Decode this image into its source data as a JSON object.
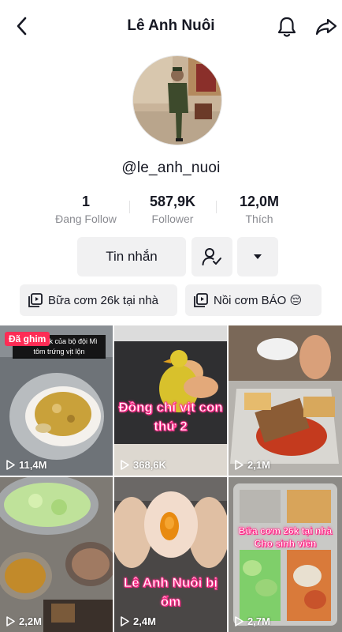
{
  "header": {
    "title": "Lê Anh Nuôi"
  },
  "profile": {
    "username": "@le_anh_nuoi"
  },
  "stats": [
    {
      "value": "1",
      "label": "Đang Follow"
    },
    {
      "value": "587,9K",
      "label": "Follower"
    },
    {
      "value": "12,0M",
      "label": "Thích"
    }
  ],
  "actions": {
    "message_label": "Tin nhắn"
  },
  "playlists": [
    {
      "label": "Bữa cơm 26k tại nhà"
    },
    {
      "label": "Nồi cơm BÁO 😔"
    }
  ],
  "videos": [
    {
      "views": "11,4M",
      "badge": "Đã ghim",
      "caption": "bữa ăn 3k của bộ đội Mì tôm trứng vịt lộn"
    },
    {
      "views": "368,6K",
      "caption": "Đồng chí vịt con thứ 2"
    },
    {
      "views": "2,1M"
    },
    {
      "views": "2,2M"
    },
    {
      "views": "2,4M",
      "caption": "Lê Anh Nuôi bị ốm"
    },
    {
      "views": "2,7M",
      "caption": "Bữa cơm 26k tại nhà Cho sinh viên"
    }
  ],
  "colors": {
    "accent": "#fe2c55",
    "button_bg": "#f1f1f2",
    "secondary_text": "#8a8b91"
  }
}
